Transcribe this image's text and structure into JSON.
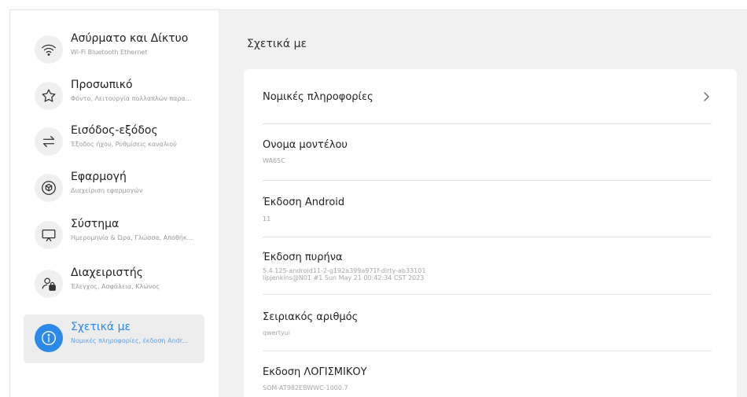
{
  "sidebar": {
    "items": [
      {
        "title": "Ασύρματο και Δίκτυο",
        "subtitle": "Wi-Fi Bluetooth Ethernet",
        "icon": "wifi-icon"
      },
      {
        "title": "Προσωπικό",
        "subtitle": "Φόντο, Λειτουργία πολλαπλών παρα...",
        "icon": "star-icon"
      },
      {
        "title": "Εισόδος-εξόδος",
        "subtitle": "Έξοδος ήχου, Ρυθμίσεις καναλιού",
        "icon": "swap-arrows-icon"
      },
      {
        "title": "Εφαρμογή",
        "subtitle": "Διαχείριση εφαρμογών",
        "icon": "cube-icon"
      },
      {
        "title": "Σύστημα",
        "subtitle": "Ημερομηνία & Ώρα, Γλώσσα, Αποθήκ...",
        "icon": "monitor-icon"
      },
      {
        "title": "Διαχειριστής",
        "subtitle": "Έλεγχος, Ασφάλεια, Κλώνος",
        "icon": "user-lock-icon"
      },
      {
        "title": "Σχετικά με",
        "subtitle": "Νομικές πληροφορίες, έκδοση Andr...",
        "icon": "info-icon",
        "active": true
      }
    ]
  },
  "main": {
    "title": "Σχετικά με",
    "rows": [
      {
        "title": "Νομικές πληροφορίες",
        "has_chevron": true
      },
      {
        "title": "Ονομα μοντέλου",
        "value": "WA65C"
      },
      {
        "title": "Έκδοση Android",
        "value": "11"
      },
      {
        "title": "Έκδοση πυρήνα",
        "value": "5.4.125-android11-2-g192a399a971f-dirty-ab33101",
        "value2": "lipjenkins@N01 #1 Sun May 21 00:42:34 CST 2023"
      },
      {
        "title": "Σειριακός αριθμός",
        "value": "qwertyui"
      },
      {
        "title": "Εκδοση ΛΟΓΙΣΜΙΚΟΥ",
        "value": "SOM-AT982EBWWC-1000.7"
      }
    ]
  },
  "colors": {
    "accent": "#2b8ae9",
    "main_bg": "#f1f1f1",
    "active_item_bg": "#ededed"
  }
}
